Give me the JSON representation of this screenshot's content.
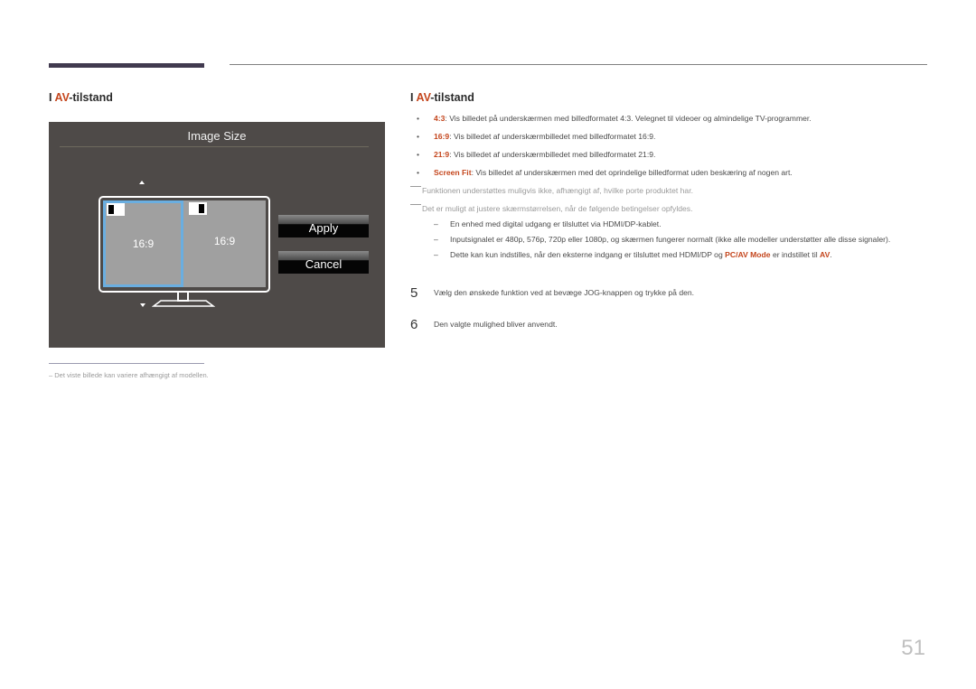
{
  "header": {
    "left_section": {
      "prefix": "I ",
      "accent": "AV",
      "suffix": "-tilstand"
    },
    "right_section": {
      "prefix": "I ",
      "accent": "AV",
      "suffix": "-tilstand"
    }
  },
  "osd": {
    "title": "Image Size",
    "panes": [
      {
        "label": "16:9",
        "selected": true
      },
      {
        "label": "16:9",
        "selected": false
      }
    ],
    "buttons": {
      "apply": "Apply",
      "cancel": "Cancel"
    },
    "colors": {
      "panel": "#4e4a48",
      "selection": "#6aaee0"
    }
  },
  "left_footnote": "–  Det viste billede kan variere afhængigt af modellen.",
  "bullets": [
    {
      "key": "4:3",
      "text": ": Vis billedet på underskærmen med billedformatet 4:3. Velegnet til videoer og almindelige TV-programmer."
    },
    {
      "key": "16:9",
      "text": ": Vis billedet af underskærmbilledet med billedformatet 16:9."
    },
    {
      "key": "21:9",
      "text": ": Vis billedet af underskærmbilledet med billedformatet 21:9."
    },
    {
      "key": "Screen Fit",
      "text": ": Vis billedet af underskærmen med det oprindelige billedformat uden beskæring af nogen art."
    }
  ],
  "notes": [
    "Funktionen understøttes muligvis ikke, afhængigt af, hvilke porte produktet har.",
    "Det er muligt at justere skærmstørrelsen, når de følgende betingelser opfyldes."
  ],
  "conditions": [
    {
      "text": "En enhed med digital udgang er tilsluttet via HDMI/DP-kablet."
    },
    {
      "text": "Inputsignalet er 480p, 576p, 720p eller 1080p, og skærmen fungerer normalt (ikke alle modeller understøtter alle disse signaler)."
    },
    {
      "text_before": "Dette kan kun indstilles, når den eksterne indgang er tilsluttet med HDMI/DP og ",
      "key1": "PC/AV Mode",
      "text_mid": " er indstillet til ",
      "key2": "AV",
      "text_after": "."
    }
  ],
  "steps": [
    {
      "number": "5",
      "text": "Vælg den ønskede funktion ved at bevæge JOG-knappen og trykke på den."
    },
    {
      "number": "6",
      "text": "Den valgte mulighed bliver anvendt."
    }
  ],
  "page_number": "51",
  "accent_color": "#c4451c"
}
